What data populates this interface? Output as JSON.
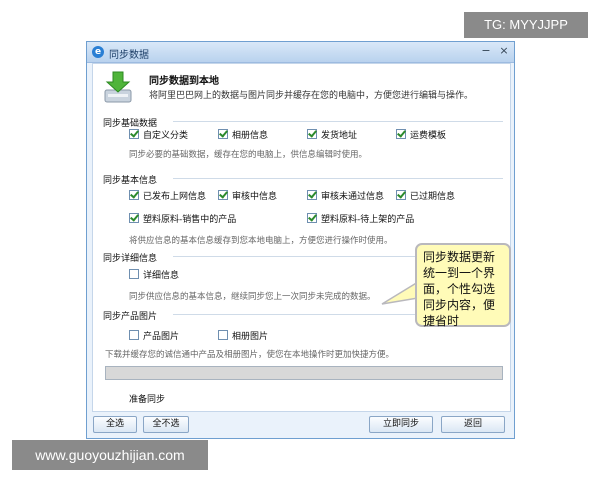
{
  "watermarks": {
    "top": "TG: MYYJJPP",
    "bottom": "www.guoyouzhijian.com"
  },
  "window": {
    "title": "同步数据",
    "close": "×",
    "restore": "−"
  },
  "header": {
    "title": "同步数据到本地",
    "description": "将阿里巴巴网上的数据与图片同步并缓存在您的电脑中，方便您进行编辑与操作。"
  },
  "sections": {
    "basic_data": {
      "title": "同步基础数据",
      "items": [
        {
          "label": "自定义分类",
          "checked": true
        },
        {
          "label": "相册信息",
          "checked": true
        },
        {
          "label": "发货地址",
          "checked": true
        },
        {
          "label": "运费模板",
          "checked": true
        }
      ],
      "description": "同步必要的基础数据，缓存在您的电脑上，供信息编辑时使用。"
    },
    "basic_info": {
      "title": "同步基本信息",
      "items": [
        {
          "label": "已发布上网信息",
          "checked": true
        },
        {
          "label": "审核中信息",
          "checked": true
        },
        {
          "label": "审核未通过信息",
          "checked": true
        },
        {
          "label": "已过期信息",
          "checked": true
        },
        {
          "label": "塑料原料-销售中的产品",
          "checked": true
        },
        {
          "label": "塑料原料-待上架的产品",
          "checked": true
        }
      ],
      "description": "将供应信息的基本信息缓存到您本地电脑上，方便您进行操作时使用。"
    },
    "detail_info": {
      "title": "同步详细信息",
      "items": [
        {
          "label": "详细信息",
          "checked": false
        }
      ],
      "description": "同步供应信息的基本信息，继续同步您上一次同步未完成的数据。"
    },
    "product_images": {
      "title": "同步产品图片",
      "items": [
        {
          "label": "产品图片",
          "checked": false
        },
        {
          "label": "相册图片",
          "checked": false
        }
      ],
      "description": "下载并缓存您的诚信通中产品及相册图片，使您在本地操作时更加快捷方便。"
    }
  },
  "progress": {
    "value": 1.0,
    "fill_color": "#d8d8d8"
  },
  "status": "准备同步",
  "buttons": {
    "select_all": "全选",
    "deselect_all": "全不选",
    "sync_now": "立即同步",
    "back": "返回"
  },
  "tooltip": "同步数据更新统一到一个界面，个性勾选同步内容，便捷省时"
}
